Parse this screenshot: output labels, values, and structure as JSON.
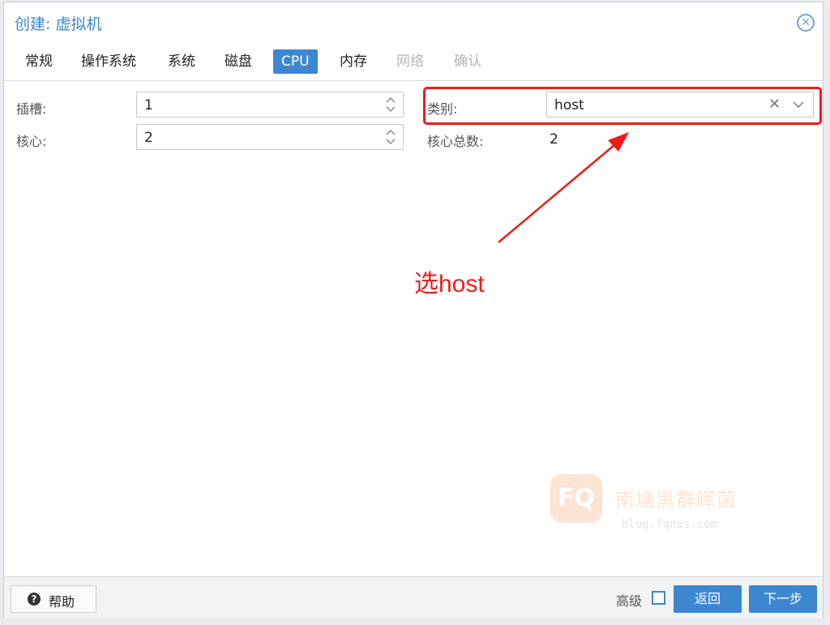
{
  "window": {
    "title": "创建: 虚拟机",
    "close_icon": "close-icon"
  },
  "tabs": [
    {
      "label": "常规",
      "state": "normal"
    },
    {
      "label": "操作系统",
      "state": "normal"
    },
    {
      "label": "系统",
      "state": "normal"
    },
    {
      "label": "磁盘",
      "state": "normal"
    },
    {
      "label": "CPU",
      "state": "active"
    },
    {
      "label": "内存",
      "state": "normal"
    },
    {
      "label": "网络",
      "state": "disabled"
    },
    {
      "label": "确认",
      "state": "disabled"
    }
  ],
  "form": {
    "sockets": {
      "label": "插槽:",
      "value": "1"
    },
    "cores": {
      "label": "核心:",
      "value": "2"
    },
    "type": {
      "label": "类别:",
      "value": "host",
      "clear_glyph": "✕"
    },
    "total_cores": {
      "label": "核心总数:",
      "value": "2"
    }
  },
  "annotation": {
    "text": "选host",
    "color": "#ee1c1c"
  },
  "watermark": {
    "logo": "FQ",
    "name": "南塘黑群晖菌",
    "url": "blog.fqnas.com"
  },
  "footer": {
    "help_label": "帮助",
    "advanced_label": "高级",
    "advanced_checked": false,
    "back_label": "返回",
    "next_label": "下一步"
  },
  "colors": {
    "accent": "#3d87d0",
    "annotation": "#f01a1a"
  }
}
